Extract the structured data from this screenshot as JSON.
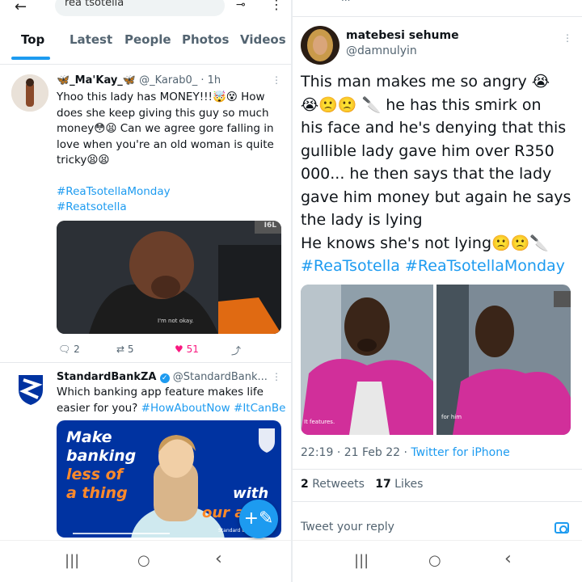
{
  "left": {
    "search": {
      "query": "rea tsotella",
      "back_icon": "arrow-left-icon",
      "filter_icon": "sliders-icon",
      "more_icon": "vertical-ellipsis-icon"
    },
    "tabs": [
      "Top",
      "Latest",
      "People",
      "Photos",
      "Videos"
    ],
    "tweet1": {
      "display_name": "🦋_Ma'Kay_🦋",
      "handle": "@_Karab0_",
      "time": "1h",
      "text_lines": [
        "Yhoo this lady has MONEY!!!🤯😵 How",
        "does she keep giving this guy so much",
        "money😳😫 Can we agree gore falling in",
        "love when you're  an old woman is quite",
        "tricky😫😫"
      ],
      "hashtags": [
        "#ReaTsotellaMonday",
        "#Reatsotella"
      ],
      "media": {
        "watermark": "I6L",
        "caption": "I'm not okay."
      },
      "actions": {
        "replies": "2",
        "retweets": "5",
        "likes": "51"
      }
    },
    "ad": {
      "display_name": "StandardBankZA",
      "handle": "@StandardBank...",
      "text_lines": [
        "Which banking app feature makes life",
        "easier for you?"
      ],
      "hashtags": [
        "#HowAboutNow",
        "#ItCanBe"
      ],
      "banner": {
        "line1": "Make",
        "line2": "banking",
        "line3": "less of",
        "line4": "a thing",
        "with": "with",
        "our": "our a",
        "footer": "Standard Ba"
      }
    },
    "nav": {
      "recent": "|||",
      "home": "○",
      "back": "‹"
    },
    "fab_icon": "+✎"
  },
  "right": {
    "top_text": "...",
    "user": {
      "display_name": "matebesi sehume",
      "handle": "@damnulyin"
    },
    "text_lines": [
      "This man makes me so angry 😭",
      "😭🙁🙁 🔪  he has this smirk on",
      "his face and he's denying that this",
      "gullible lady gave him over R350",
      "000... he then says that the lady",
      "gave him money but again he says",
      "the lady is lying",
      "He knows she's not lying🙁🙁🔪"
    ],
    "hashtags": [
      "#ReaTsotella",
      "#ReaTsotellaMonday"
    ],
    "media": {
      "left_caption": "It features.",
      "right_caption": "for him"
    },
    "meta": {
      "time": "22:19",
      "date": "21 Feb 22",
      "source": "Twitter for iPhone"
    },
    "stats": {
      "retweets_count": "2",
      "retweets_label": "Retweets",
      "likes_count": "17",
      "likes_label": "Likes"
    },
    "reply_placeholder": "Tweet your reply",
    "nav": {
      "recent": "|||",
      "home": "○",
      "back": "‹"
    }
  },
  "colors": {
    "accent": "#1d9bf0",
    "like": "#f91880",
    "bank_blue": "#0033a1"
  }
}
